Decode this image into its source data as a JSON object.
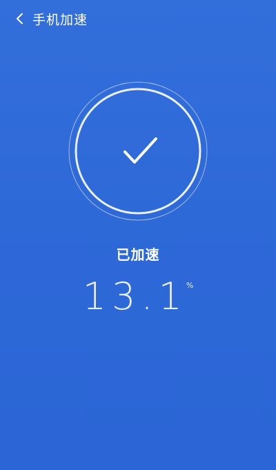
{
  "header": {
    "title": "手机加速",
    "back_icon": "chevron-left-icon"
  },
  "result": {
    "status": "已加速",
    "value": "13.1",
    "unit": "%",
    "icon": "checkmark-icon"
  },
  "colors": {
    "background": "#2f6ad9",
    "foreground": "#ffffff",
    "ring": "#ffffff"
  }
}
